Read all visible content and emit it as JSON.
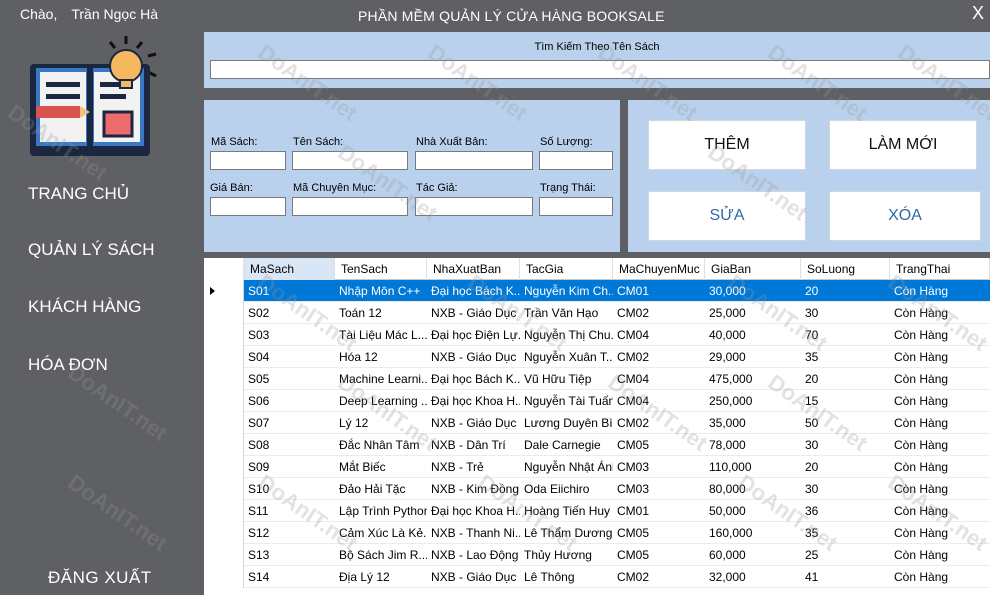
{
  "header": {
    "greeting": "Chào,",
    "user_name": "Trần Ngọc Hà",
    "app_title": "PHẦN MỀM QUẢN LÝ CỬA HÀNG BOOKSALE",
    "close_label": "X"
  },
  "sidebar": {
    "logo_icon": "book-lightbulb-icon",
    "items": [
      {
        "label": "TRANG CHỦ"
      },
      {
        "label": "QUẢN LÝ SÁCH"
      },
      {
        "label": "KHÁCH HÀNG"
      },
      {
        "label": "HÓA ĐƠN"
      }
    ],
    "logout_label": "ĐĂNG XUẤT"
  },
  "search": {
    "label": "Tìm Kiếm Theo Tên Sách",
    "value": ""
  },
  "form": {
    "ma_sach": {
      "label": "Mã Sách:",
      "value": ""
    },
    "ten_sach": {
      "label": "Tên Sách:",
      "value": ""
    },
    "nha_xuat_ban": {
      "label": "Nhà Xuất Bản:",
      "value": ""
    },
    "so_luong": {
      "label": "Số Lượng:",
      "value": ""
    },
    "gia_ban": {
      "label": "Giá Bán:",
      "value": ""
    },
    "ma_chuyen_muc": {
      "label": "Mã Chuyên Mục:",
      "value": ""
    },
    "tac_gia": {
      "label": "Tác Giả:",
      "value": ""
    },
    "trang_thai": {
      "label": "Trạng Thái:",
      "value": ""
    }
  },
  "buttons": {
    "them": "THÊM",
    "lam_moi": "LÀM MỚI",
    "sua": "SỬA",
    "xoa": "XÓA"
  },
  "grid": {
    "columns": [
      "MaSach",
      "TenSach",
      "NhaXuatBan",
      "TacGia",
      "MaChuyenMuc",
      "GiaBan",
      "SoLuong",
      "TrangThai"
    ],
    "rows": [
      [
        "S01",
        "Nhập Môn C++",
        "Đại học Bách K...",
        "Nguyễn Kim Ch...",
        "CM01",
        "30,000",
        "20",
        "Còn Hàng"
      ],
      [
        "S02",
        "Toán 12",
        "NXB - Giáo Dục",
        "Trần Văn Hạo",
        "CM02",
        "25,000",
        "30",
        "Còn Hàng"
      ],
      [
        "S03",
        "Tài Liệu Mác L...",
        "Đại học Điện Lự...",
        "Nguyễn Thị Chu...",
        "CM04",
        "40,000",
        "70",
        "Còn Hàng"
      ],
      [
        "S04",
        "Hóa 12",
        "NXB - Giáo Dục",
        "Nguyễn Xuân T...",
        "CM02",
        "29,000",
        "35",
        "Còn Hàng"
      ],
      [
        "S05",
        "Machine Learni...",
        "Đại học Bách K...",
        "Vũ Hữu Tiệp",
        "CM04",
        "475,000",
        "20",
        "Còn Hàng"
      ],
      [
        "S06",
        "Deep Learning ...",
        "Đại học Khoa H...",
        "Nguyễn Tài Tuấn",
        "CM04",
        "250,000",
        "15",
        "Còn Hàng"
      ],
      [
        "S07",
        "Lý 12",
        "NXB - Giáo Dục",
        "Lương Duyên Bì...",
        "CM02",
        "35,000",
        "50",
        "Còn Hàng"
      ],
      [
        "S08",
        "Đắc Nhân Tâm",
        "NXB - Dân Trí",
        "Dale Carnegie",
        "CM05",
        "78,000",
        "30",
        "Còn Hàng"
      ],
      [
        "S09",
        "Mắt Biếc",
        "NXB - Trẻ",
        "Nguyễn Nhật Ánh",
        "CM03",
        "110,000",
        "20",
        "Còn Hàng"
      ],
      [
        "S10",
        "Đảo Hải Tặc",
        "NXB - Kim Đồng",
        "Oda Eiichiro",
        "CM03",
        "80,000",
        "30",
        "Còn Hàng"
      ],
      [
        "S11",
        "Lập Trình Python",
        "Đại học Khoa H...",
        "Hoàng Tiến Huy",
        "CM01",
        "50,000",
        "36",
        "Còn Hàng"
      ],
      [
        "S12",
        "Cảm Xúc Là Kẻ...",
        "NXB - Thanh Ni...",
        "Lê Thẩm Dương",
        "CM05",
        "160,000",
        "35",
        "Còn Hàng"
      ],
      [
        "S13",
        "Bộ Sách Jim R...",
        "NXB - Lao Động",
        "Thủy Hương",
        "CM05",
        "60,000",
        "25",
        "Còn Hàng"
      ],
      [
        "S14",
        "Địa Lý 12",
        "NXB - Giáo Dục",
        "Lê Thông",
        "CM02",
        "32,000",
        "41",
        "Còn Hàng"
      ]
    ],
    "selected_row": 0
  },
  "watermark": "DoAnIT.net",
  "colors": {
    "sidebar_bg": "#5f6063",
    "panel_bg": "#b9d1ec",
    "selection": "#0078d7",
    "button_text_blue": "#2f6aa3"
  }
}
